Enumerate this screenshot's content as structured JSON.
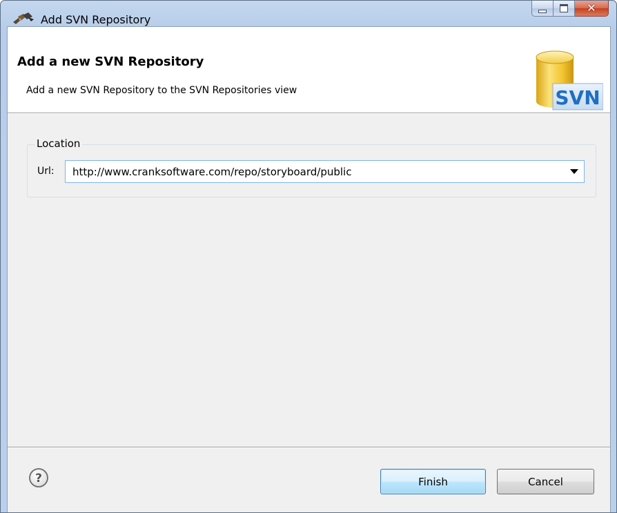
{
  "window": {
    "title": "Add SVN Repository",
    "icon": "plug-connector-icon",
    "controls": [
      "minimize",
      "maximize",
      "close"
    ]
  },
  "banner": {
    "title": "Add a new SVN Repository",
    "description": "Add a new SVN Repository to the SVN Repositories view",
    "logo_text": "SVN",
    "logo_icon": "database-cylinder-icon"
  },
  "location": {
    "group_label": "Location",
    "url_label": "Url:",
    "url_value": "http://www.cranksoftware.com/repo/storyboard/public"
  },
  "footer": {
    "help_icon": "question-mark-icon",
    "finish_label": "Finish",
    "cancel_label": "Cancel"
  },
  "colors": {
    "title_bar": "#b9cfea",
    "close_button": "#c4401f",
    "default_button": "#a7d9f5",
    "svn_logo_blue": "#1f6fc2",
    "svn_cylinder_yellow": "#f4c530"
  }
}
